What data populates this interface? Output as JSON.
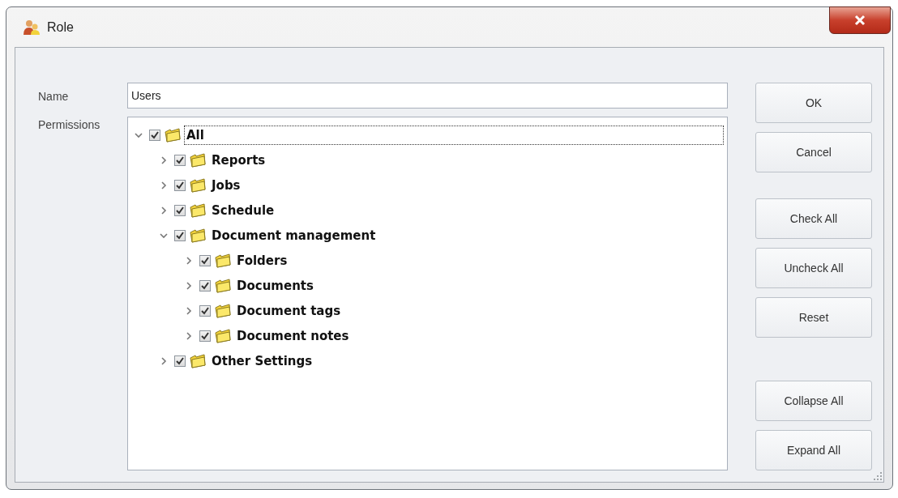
{
  "window": {
    "title": "Role"
  },
  "name_field": {
    "label": "Name",
    "value": "Users"
  },
  "permissions": {
    "label": "Permissions",
    "tree": [
      {
        "label": "All",
        "checked": true,
        "expanded": true,
        "selected": true,
        "children": [
          {
            "label": "Reports",
            "checked": true,
            "expanded": false,
            "selected": false
          },
          {
            "label": "Jobs",
            "checked": true,
            "expanded": false,
            "selected": false
          },
          {
            "label": "Schedule",
            "checked": true,
            "expanded": false,
            "selected": false
          },
          {
            "label": "Document management",
            "checked": true,
            "expanded": true,
            "selected": false,
            "children": [
              {
                "label": "Folders",
                "checked": true,
                "expanded": false,
                "selected": false
              },
              {
                "label": "Documents",
                "checked": true,
                "expanded": false,
                "selected": false
              },
              {
                "label": "Document tags",
                "checked": true,
                "expanded": false,
                "selected": false
              },
              {
                "label": "Document notes",
                "checked": true,
                "expanded": false,
                "selected": false
              }
            ]
          },
          {
            "label": "Other Settings",
            "checked": true,
            "expanded": false,
            "selected": false
          }
        ]
      }
    ]
  },
  "button_groups": [
    [
      "OK",
      "Cancel"
    ],
    [
      "Check All",
      "Uncheck All",
      "Reset"
    ],
    [
      "Collapse All",
      "Expand All"
    ]
  ]
}
